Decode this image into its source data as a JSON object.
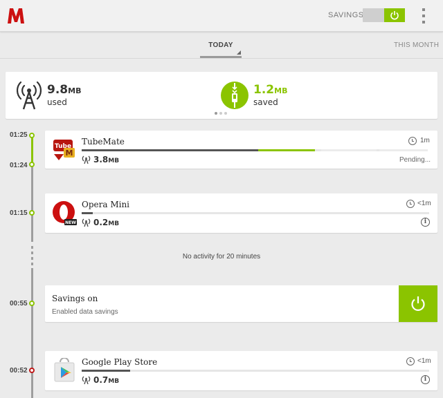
{
  "header": {
    "savings_label": "SAVINGS",
    "savings_on": true,
    "accent_color": "#8bc400",
    "brand_color": "#cc1010"
  },
  "tabs": [
    {
      "label": "TODAY",
      "active": true
    },
    {
      "label": "THIS MONTH",
      "active": false
    }
  ],
  "summary": {
    "used_value": "9.8",
    "used_unit": "MB",
    "used_label": "used",
    "saved_value": "1.2",
    "saved_unit": "MB",
    "saved_label": "saved",
    "page_dots": 3,
    "active_dot": 0
  },
  "timeline": {
    "entries": [
      {
        "type": "app",
        "name": "TubeMate",
        "icon": "tubemate-icon",
        "start_time": "01:25",
        "end_time": "01:24",
        "duration": "1m",
        "usage_value": "3.8",
        "usage_unit": "MB",
        "status": "Pending..."
      },
      {
        "type": "app",
        "name": "Opera Mini",
        "icon": "opera-mini-icon",
        "time": "01:15",
        "duration": "<1m",
        "usage_value": "0.2",
        "usage_unit": "MB"
      },
      {
        "type": "gap",
        "text": "No activity for 20 minutes"
      },
      {
        "type": "event",
        "time": "00:55",
        "title": "Savings on",
        "subtitle": "Enabled data savings"
      },
      {
        "type": "app",
        "name": "Google Play Store",
        "icon": "google-play-store-icon",
        "time": "00:52",
        "duration": "<1m",
        "usage_value": "0.7",
        "usage_unit": "MB"
      }
    ]
  },
  "icons": {
    "logo": "opera-max-logo-icon",
    "menu": "overflow-menu-icon",
    "power": "power-icon",
    "signal": "signal-icon",
    "clock": "clock-icon",
    "info": "info-icon",
    "zip": "zip-compress-icon"
  }
}
